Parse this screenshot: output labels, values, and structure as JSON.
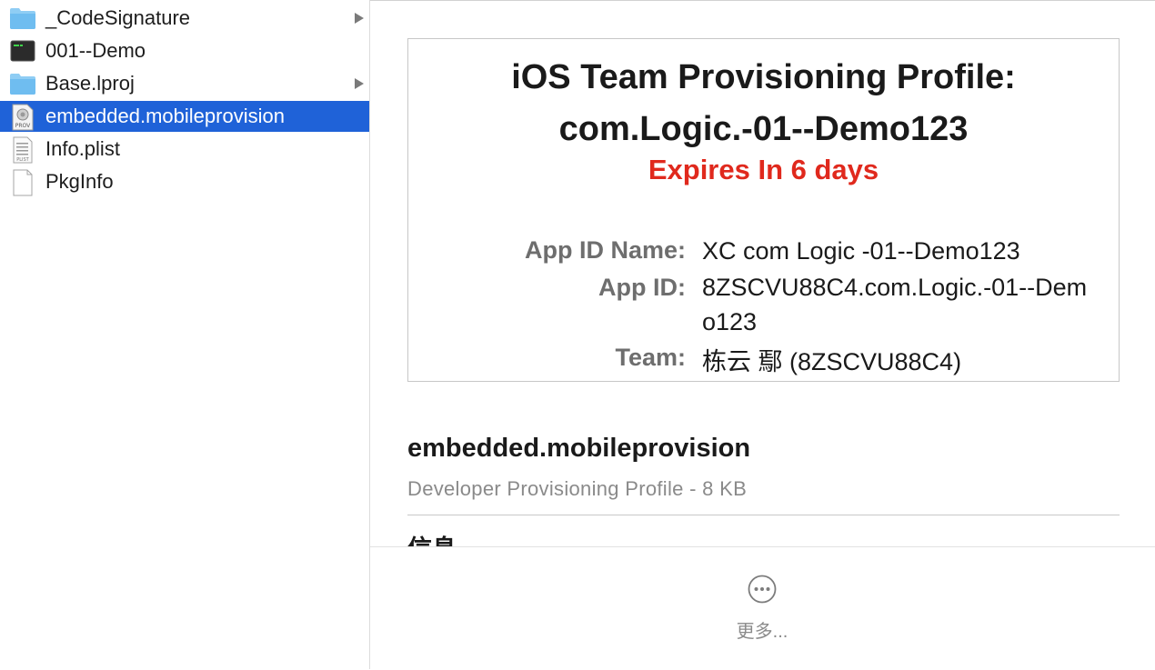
{
  "sidebar": {
    "items": [
      {
        "label": "_CodeSignature",
        "icon": "folder-icon",
        "expandable": true,
        "selected": false
      },
      {
        "label": "001--Demo",
        "icon": "terminal-executable-icon",
        "expandable": false,
        "selected": false
      },
      {
        "label": "Base.lproj",
        "icon": "folder-icon",
        "expandable": true,
        "selected": false
      },
      {
        "label": "embedded.mobileprovision",
        "icon": "prov-file-icon",
        "expandable": false,
        "selected": true
      },
      {
        "label": "Info.plist",
        "icon": "plist-file-icon",
        "expandable": false,
        "selected": false
      },
      {
        "label": "PkgInfo",
        "icon": "blank-file-icon",
        "expandable": false,
        "selected": false
      }
    ],
    "icon_text": {
      "prov": "PROV",
      "plist": "PLIST"
    }
  },
  "preview": {
    "title_line1": "iOS Team Provisioning Profile:",
    "title_line2": "com.Logic.-01--Demo123",
    "expires": "Expires In 6 days",
    "fields": [
      {
        "key": "App ID Name:",
        "value": "XC com Logic -01--Demo123"
      },
      {
        "key": "App ID:",
        "value": "8ZSCVU88C4.com.Logic.-01--Demo123"
      },
      {
        "key": "Team:",
        "value": "栋云 鄢 (8ZSCVU88C4)"
      }
    ]
  },
  "file_info": {
    "name": "embedded.mobileprovision",
    "subtitle": "Developer Provisioning Profile - 8 KB",
    "section_heading": "信息"
  },
  "more": {
    "label": "更多...",
    "icon": "ellipsis-circle-icon"
  },
  "colors": {
    "selection": "#1f62d8",
    "expires": "#e0291d",
    "folder": "#6fbdf0"
  }
}
